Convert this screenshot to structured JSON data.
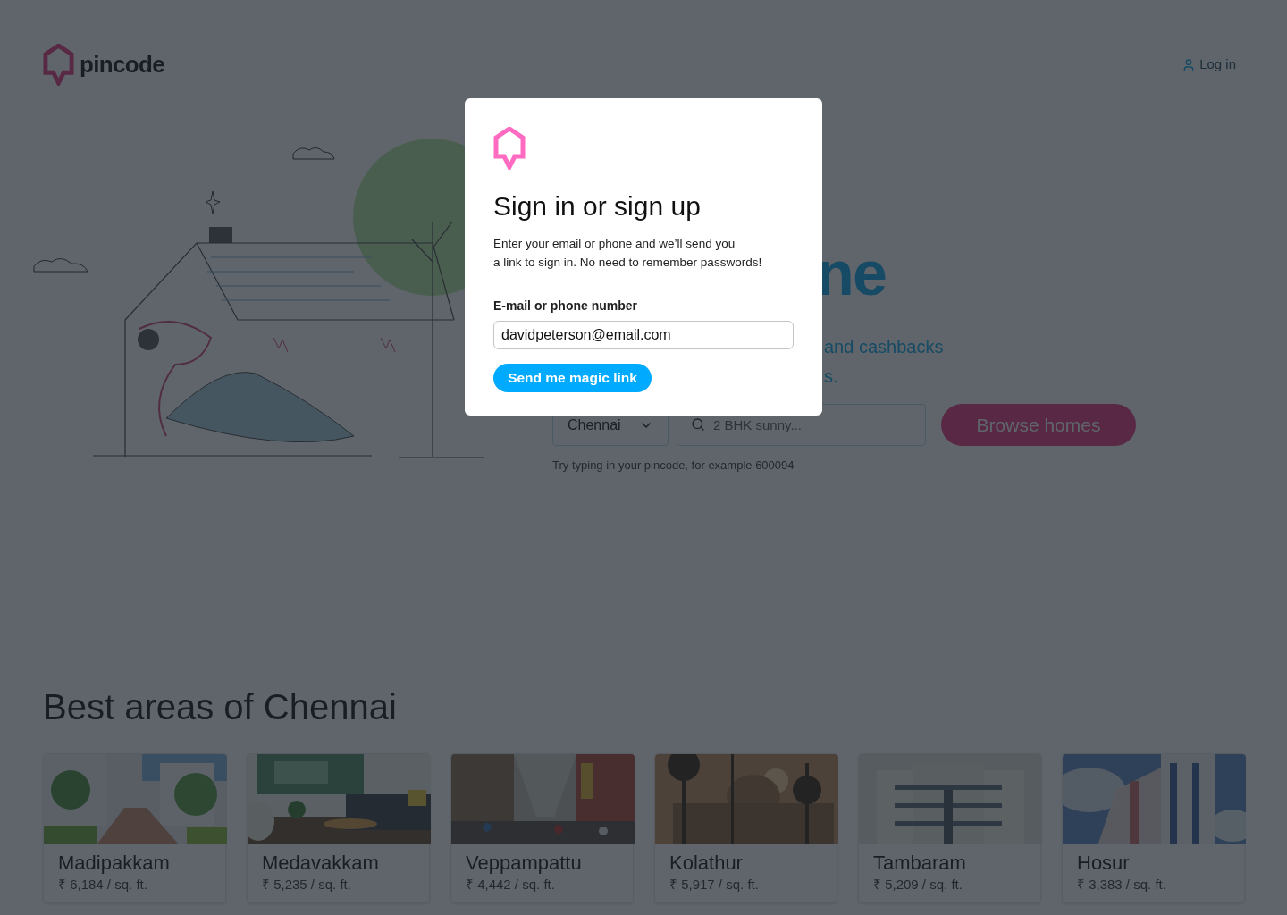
{
  "header": {
    "logo": "pincode",
    "login": "Log in"
  },
  "hero": {
    "title_fragment": "ne",
    "subtitle_lines": [
      "and cashbacks",
      "s."
    ],
    "city_select": {
      "value": "Chennai"
    },
    "search": {
      "placeholder": "2 BHK sunny..."
    },
    "browse_button": "Browse homes",
    "hint": "Try typing in your pincode, for example 600094"
  },
  "areas": {
    "title": "Best areas of Chennai",
    "cards": [
      {
        "name": "Madipakkam",
        "price": "₹ 6,184 / sq. ft.",
        "kind": "picture"
      },
      {
        "name": "Medavakkam",
        "price": "₹ 5,235 / sq. ft.",
        "kind": "picture"
      },
      {
        "name": "Veppampattu",
        "price": "₹ 4,442 / sq. ft.",
        "kind": "picture"
      },
      {
        "name": "Kolathur",
        "price": "₹ 5,917 / sq. ft.",
        "kind": "picture"
      },
      {
        "name": "Tambaram",
        "price": "₹ 5,209 / sq. ft.",
        "kind": "picture"
      },
      {
        "name": "Hosur",
        "price": "₹ 3,383 / sq. ft.",
        "kind": "picture"
      }
    ]
  },
  "modal": {
    "title": "Sign in or sign up",
    "description_lines": [
      "Enter your email or phone and we’ll send you",
      "a link to sign in. No need to remember passwords!"
    ],
    "field": {
      "label": "E-mail or phone number",
      "value": "davidpeterson@email.com"
    },
    "submit": "Send me magic link"
  }
}
